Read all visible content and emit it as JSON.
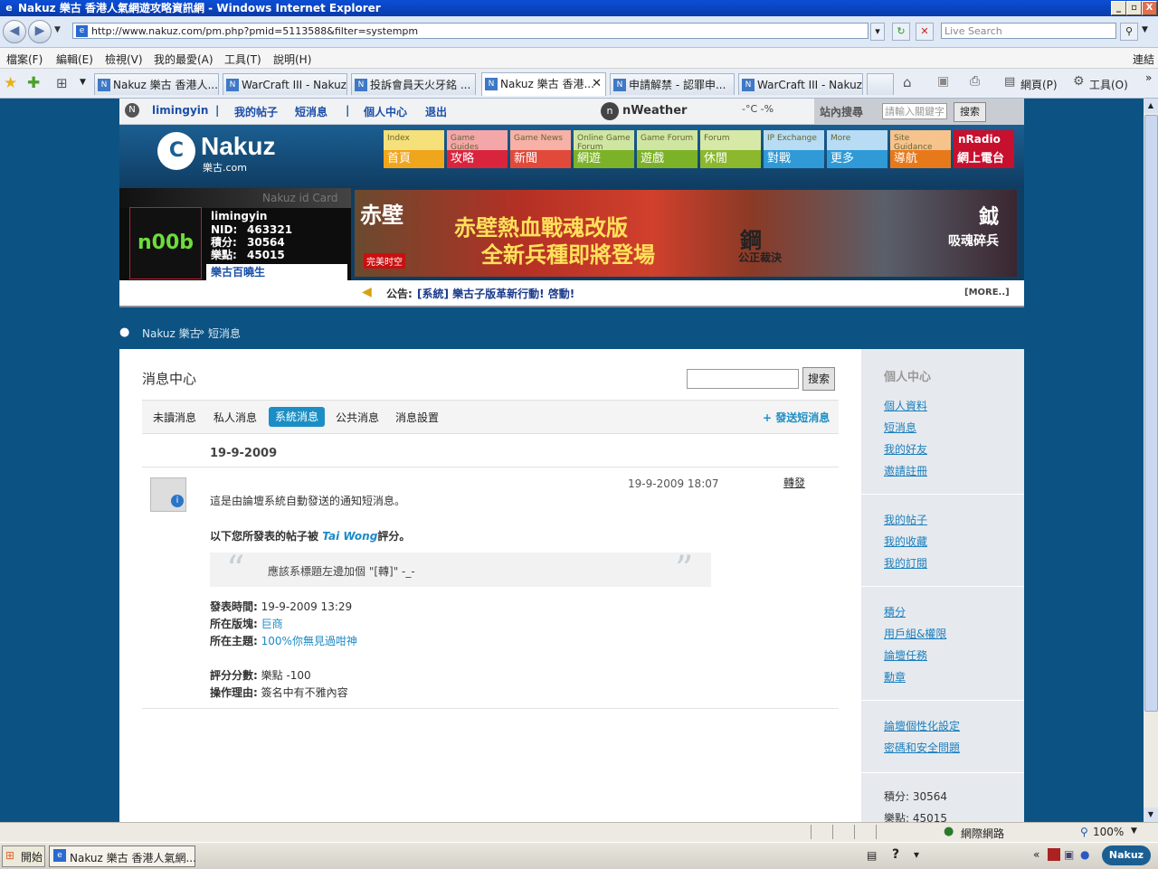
{
  "window": {
    "title": "Nakuz 樂古 香港人氣網遊攻略資訊網 - Windows Internet Explorer",
    "buttons": [
      "_",
      "▫",
      "X"
    ]
  },
  "address": {
    "url": "http://www.nakuz.com/pm.php?pmid=5113588&filter=systempm",
    "search_placeholder": "Live Search"
  },
  "menu": {
    "items": [
      "檔案(F)",
      "編輯(E)",
      "檢視(V)",
      "我的最愛(A)",
      "工具(T)",
      "說明(H)"
    ],
    "links": "連結"
  },
  "tabs": [
    {
      "label": "Nakuz 樂古 香港人..."
    },
    {
      "label": "WarCraft III - Nakuz ..."
    },
    {
      "label": "投訴會員天火牙銘 ..."
    },
    {
      "label": "Nakuz 樂古 香港...",
      "active": true
    },
    {
      "label": "申請解禁 - 認罪申..."
    },
    {
      "label": "WarCraft III - Nakuz ..."
    }
  ],
  "toolbar": {
    "page": "網頁(P)",
    "tools": "工具(O)"
  },
  "site": {
    "top_links": [
      "limingyin",
      "我的帖子",
      "短消息",
      "個人中心",
      "退出"
    ],
    "weather_label": "nWeather",
    "weather_value": "-°C -%",
    "site_search_label": "站內搜尋",
    "site_search_placeholder": "請輸入關鍵字",
    "site_search_button": "搜索",
    "logo_text": "Nakuz",
    "logo_sub": "樂古.com",
    "nav": [
      {
        "en": "Index",
        "zh": "首頁",
        "top": "#f6e07a",
        "bottom": "#efa51c"
      },
      {
        "en": "Game Guides",
        "zh": "攻略",
        "top": "#f4a7a9",
        "bottom": "#d8253d"
      },
      {
        "en": "Game News",
        "zh": "新聞",
        "top": "#f7b1a7",
        "bottom": "#e14a3a"
      },
      {
        "en": "Online Game Forum",
        "zh": "網遊",
        "top": "#cfe6a2",
        "bottom": "#7cb227"
      },
      {
        "en": "Game Forum",
        "zh": "遊戲",
        "top": "#cfe6a2",
        "bottom": "#7cb227"
      },
      {
        "en": "Forum",
        "zh": "休閒",
        "top": "#d6e9a6",
        "bottom": "#8bb82d"
      },
      {
        "en": "IP Exchange",
        "zh": "對戰",
        "top": "#b7dcf3",
        "bottom": "#2f9ad6"
      },
      {
        "en": "More",
        "zh": "更多",
        "top": "#b7dcf3",
        "bottom": "#2f9ad6"
      },
      {
        "en": "Site Guidance",
        "zh": "導航",
        "top": "#f7c38d",
        "bottom": "#e8791b"
      }
    ],
    "nradio_label": "nRadio",
    "nradio_sub": "網上電台",
    "idcard_title": "Nakuz id Card",
    "avatar_text": "n00b",
    "username": "limingyin",
    "stats": [
      {
        "k": "NID:",
        "v": "463321"
      },
      {
        "k": "積分:",
        "v": "30564"
      },
      {
        "k": "樂點:",
        "v": "45015"
      }
    ],
    "rank": "樂古百曉生",
    "banner_text1": "赤壁熱血戰魂改版",
    "banner_text2": "全新兵種即將登場",
    "banner_brand": "赤壁",
    "banner_brand_sub": "完美时空",
    "banner_right1": "鋼",
    "banner_right1_sub": "公正裁決",
    "banner_right2": "鉞",
    "banner_right2_sub": "吸魂碎兵",
    "notice_label": "公告:",
    "notice_text": "[系統] 樂古子版革新行動! 啓動!",
    "notice_more": "[MORE..]"
  },
  "breadcrumb": {
    "home": "Nakuz 樂古",
    "sep": "»",
    "current": "短消息"
  },
  "msgcenter": {
    "title": "消息中心",
    "search_button": "搜索",
    "tabs": [
      "未讀消息",
      "私人消息",
      "系統消息",
      "公共消息",
      "消息設置"
    ],
    "send_label": "+ 發送短消息",
    "date_heading": "19-9-2009",
    "timestamp": "19-9-2009 18:07",
    "forward": "轉發",
    "intro": "這是由論壇系統自動發送的通知短消息。",
    "line_prefix": "以下您所發表的帖子被",
    "rater": "Tai Wong",
    "line_suffix": "評分。",
    "quote": "應該系標題左邊加個 \"[轉]\" -_-",
    "details": [
      {
        "k": "發表時間:",
        "v": "19-9-2009 13:29",
        "link": false
      },
      {
        "k": "所在版塊:",
        "v": "巨商",
        "link": true
      },
      {
        "k": "所在主題:",
        "v": "100%你無見過咁神",
        "link": true
      }
    ],
    "details2": [
      {
        "k": "評分分數:",
        "v": "樂點 -100"
      },
      {
        "k": "操作理由:",
        "v": "簽名中有不雅內容"
      }
    ]
  },
  "sidebar": {
    "title": "個人中心",
    "group1": [
      "個人資料",
      "短消息",
      "我的好友",
      "邀請註冊"
    ],
    "group2": [
      "我的帖子",
      "我的收藏",
      "我的訂閱"
    ],
    "group3": [
      "積分",
      "用戶組&權限",
      "論壇任務",
      "勳章"
    ],
    "group4": [
      "論壇個性化設定",
      "密碼和安全問題"
    ],
    "points": "積分: 30564",
    "ledian": "樂點: 45015"
  },
  "status": {
    "zone": "網際網路",
    "zoom": "100%"
  },
  "taskbar": {
    "start": "開始",
    "window": "Nakuz 樂古 香港人氣網...",
    "tray": "Nakuz"
  }
}
